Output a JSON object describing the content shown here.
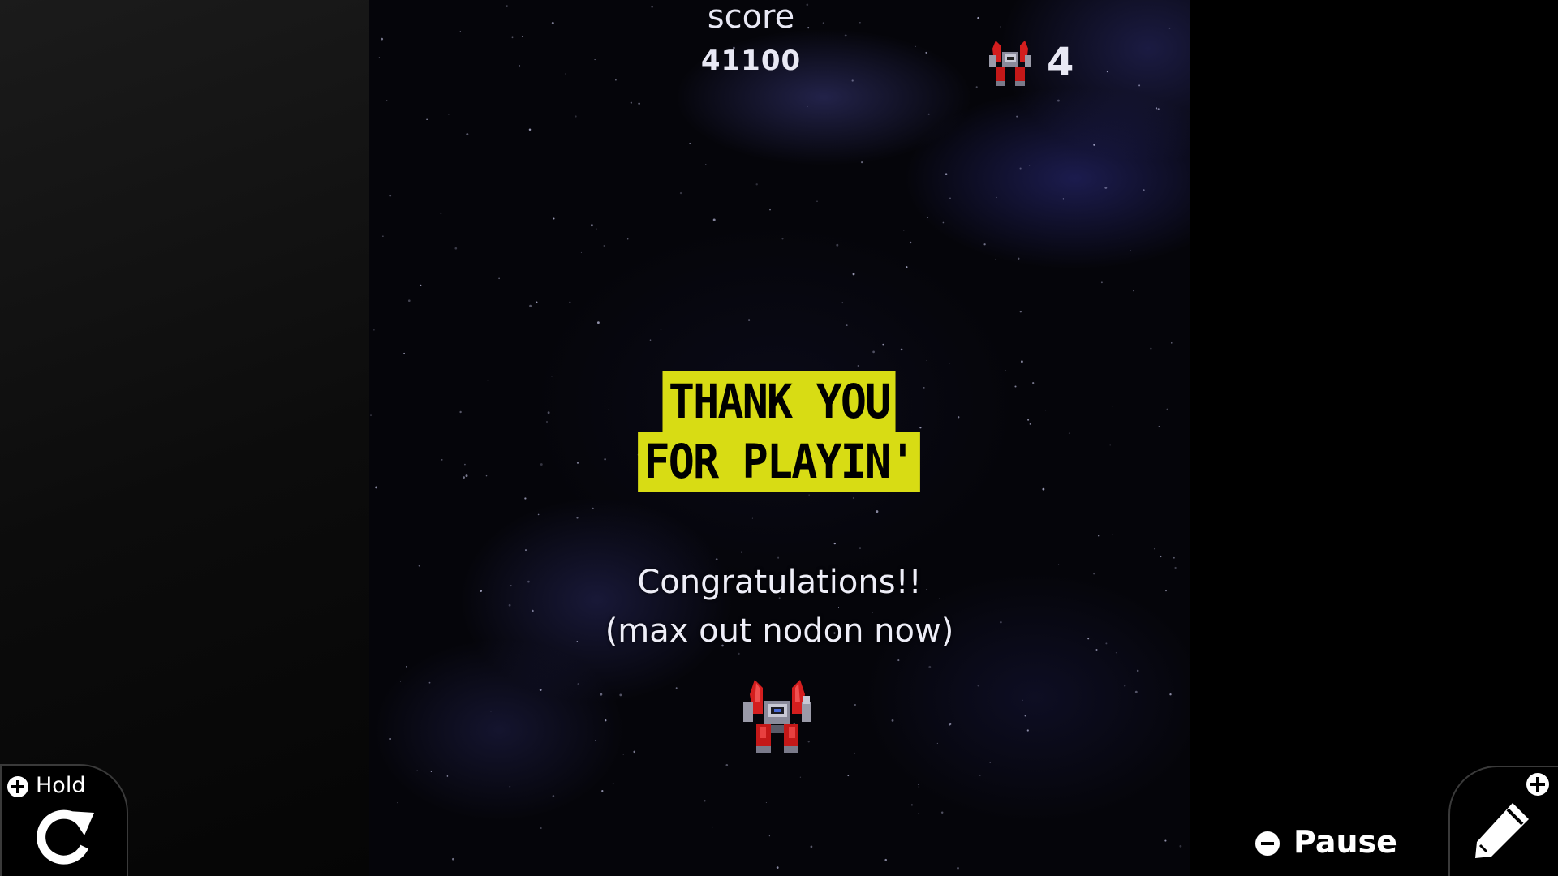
{
  "hud": {
    "score_label": "score",
    "score_value": "41100",
    "lives_count": "4",
    "lives_icon": "player-ship-icon"
  },
  "banner": {
    "line1": "THANK YOU",
    "line2": "FOR PLAYIN'",
    "color": "#d8dc14"
  },
  "message": {
    "line1": "Congratulations!!",
    "line2": "(max out nodon now)"
  },
  "controls": {
    "hold_label": "Hold",
    "hold_icon": "rotate-icon",
    "pause_label": "Pause",
    "edit_icon": "pencil-icon"
  }
}
